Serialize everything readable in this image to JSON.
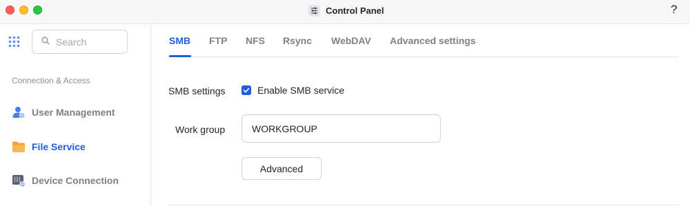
{
  "window": {
    "title": "Control Panel",
    "help_label": "?",
    "traffic_lights": {
      "close": "#fe5f57",
      "minimize": "#febc2e",
      "zoom": "#28c840"
    }
  },
  "sidebar": {
    "search_placeholder": "Search",
    "section_label": "Connection & Access",
    "items": [
      {
        "label": "User Management",
        "icon": "user-management-icon",
        "active": false
      },
      {
        "label": "File Service",
        "icon": "folder-icon",
        "active": true
      },
      {
        "label": "Device Connection",
        "icon": "device-connection-icon",
        "active": false
      }
    ]
  },
  "tabs": [
    {
      "label": "SMB",
      "active": true
    },
    {
      "label": "FTP",
      "active": false
    },
    {
      "label": "NFS",
      "active": false
    },
    {
      "label": "Rsync",
      "active": false
    },
    {
      "label": "WebDAV",
      "active": false
    },
    {
      "label": "Advanced settings",
      "active": false
    }
  ],
  "form": {
    "smb_settings_label": "SMB settings",
    "enable_smb_label": "Enable SMB service",
    "enable_smb_checked": true,
    "work_group_label": "Work group",
    "work_group_value": "WORKGROUP",
    "advanced_button_label": "Advanced"
  },
  "colors": {
    "accent": "#1f5ce0",
    "text": "#1f2329",
    "muted": "#7c8189",
    "border": "#cfd3da"
  }
}
